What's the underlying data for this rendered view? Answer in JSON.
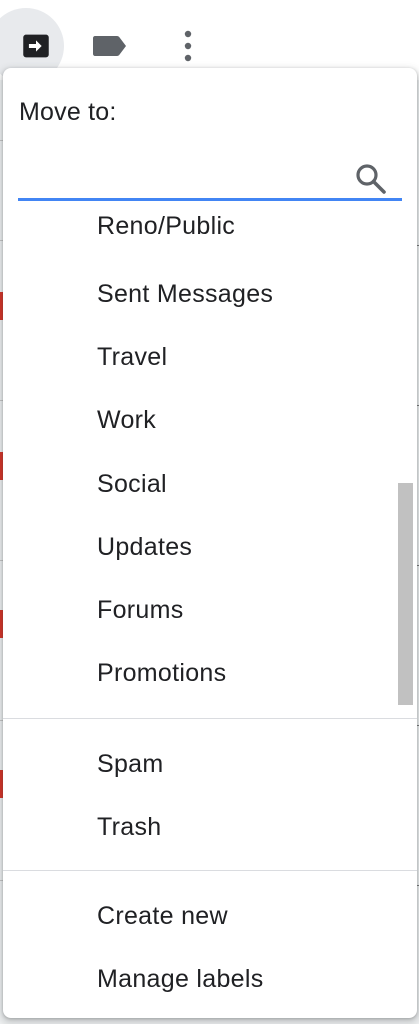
{
  "toolbar": {
    "icons": [
      "move-to-icon",
      "label-icon",
      "more-vert-icon"
    ]
  },
  "move_menu": {
    "title": "Move to:",
    "search": {
      "value": "",
      "placeholder": ""
    },
    "folders": [
      {
        "label": "Reno/Public",
        "partially_visible": true
      },
      {
        "label": "Sent Messages"
      },
      {
        "label": "Travel"
      },
      {
        "label": "Work"
      },
      {
        "label": "Social"
      },
      {
        "label": "Updates"
      },
      {
        "label": "Forums"
      },
      {
        "label": "Promotions"
      }
    ],
    "system_folders": [
      {
        "label": "Spam"
      },
      {
        "label": "Trash"
      }
    ],
    "actions": [
      {
        "label": "Create new"
      },
      {
        "label": "Manage labels"
      }
    ]
  },
  "colors": {
    "accent": "#4285f4",
    "text": "#202124",
    "divider": "#dadce0",
    "icon": "#5f6368",
    "active_button_bg": "#e8eaed"
  }
}
